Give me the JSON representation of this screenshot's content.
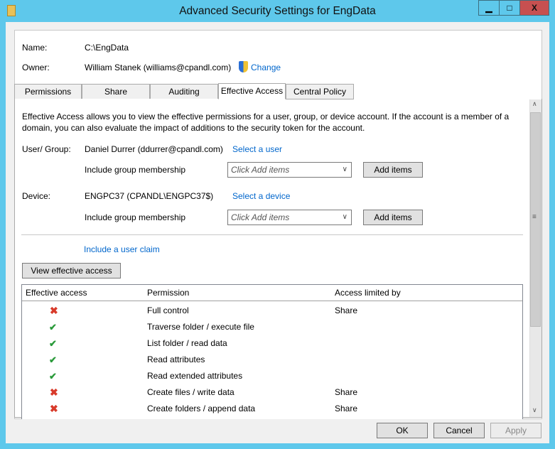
{
  "window": {
    "title": "Advanced Security Settings for EngData",
    "minimize": "▁",
    "maximize": "□",
    "close": "X"
  },
  "header": {
    "name_label": "Name:",
    "name_value": "C:\\EngData",
    "owner_label": "Owner:",
    "owner_value": "William Stanek (williams@cpandl.com)",
    "change_link": "Change"
  },
  "tabs": [
    {
      "label": "Permissions"
    },
    {
      "label": "Share"
    },
    {
      "label": "Auditing"
    },
    {
      "label": "Effective Access",
      "active": true
    },
    {
      "label": "Central Policy"
    }
  ],
  "effective": {
    "description": "Effective Access allows you to view the effective permissions for a user, group, or device account. If the account is a member of a domain, you can also evaluate the impact of additions to the security token for the account.",
    "user_label": "User/ Group:",
    "user_value": "Daniel Durrer (ddurrer@cpandl.com)",
    "select_user": "Select a user",
    "include_group": "Include group membership",
    "combo_placeholder": "Click Add items",
    "add_items": "Add items",
    "device_label": "Device:",
    "device_value": "ENGPC37 (CPANDL\\ENGPC37$)",
    "select_device": "Select a device",
    "include_claim": "Include a user claim",
    "view_button": "View effective access"
  },
  "table": {
    "headers": [
      "Effective access",
      "Permission",
      "Access limited by"
    ],
    "rows": [
      {
        "access": "denied",
        "icon": "red-x-icon",
        "permission": "Full control",
        "limited_by": "Share"
      },
      {
        "access": "allowed",
        "icon": "green-check-group-icon",
        "permission": "Traverse folder / execute file",
        "limited_by": ""
      },
      {
        "access": "allowed",
        "icon": "green-check-group-icon",
        "permission": "List folder / read data",
        "limited_by": ""
      },
      {
        "access": "allowed",
        "icon": "green-check-group-icon",
        "permission": "Read attributes",
        "limited_by": ""
      },
      {
        "access": "allowed",
        "icon": "green-check-group-icon",
        "permission": "Read extended attributes",
        "limited_by": ""
      },
      {
        "access": "denied",
        "icon": "red-x-icon",
        "permission": "Create files / write data",
        "limited_by": "Share"
      },
      {
        "access": "denied",
        "icon": "red-x-icon",
        "permission": "Create folders / append data",
        "limited_by": "Share"
      }
    ]
  },
  "footer": {
    "ok": "OK",
    "cancel": "Cancel",
    "apply": "Apply"
  }
}
